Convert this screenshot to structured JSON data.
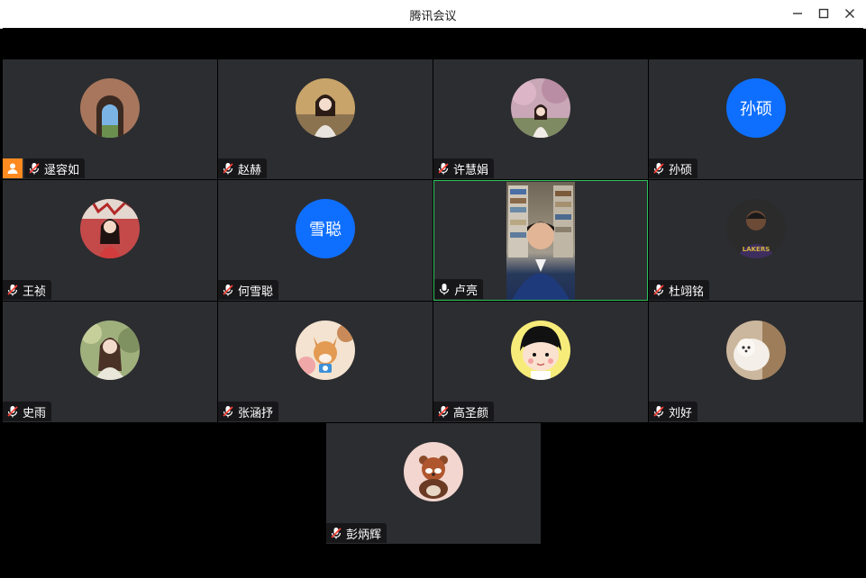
{
  "window": {
    "title": "腾讯会议"
  },
  "participants": [
    {
      "name": "逯容如",
      "avatar": "photo-tunnel",
      "host": true,
      "muted": true
    },
    {
      "name": "赵赫",
      "avatar": "photo-girl-autumn",
      "host": false,
      "muted": true
    },
    {
      "name": "许慧娟",
      "avatar": "photo-girl-blossom",
      "host": false,
      "muted": true
    },
    {
      "name": "孙硕",
      "avatar_text": "孙硕",
      "host": false,
      "muted": true
    },
    {
      "name": "王祯",
      "avatar": "photo-girl-red",
      "host": false,
      "muted": true
    },
    {
      "name": "何雪聪",
      "avatar_text": "雪聪",
      "host": false,
      "muted": true
    },
    {
      "name": "卢亮",
      "avatar": "video-feed",
      "host": false,
      "muted": false,
      "active": true
    },
    {
      "name": "杜翊铭",
      "avatar": "photo-basketball",
      "host": false,
      "muted": true
    },
    {
      "name": "史雨",
      "avatar": "photo-girl-garden",
      "host": false,
      "muted": true
    },
    {
      "name": "张涵抒",
      "avatar": "photo-corgi",
      "host": false,
      "muted": true
    },
    {
      "name": "高圣颜",
      "avatar": "cartoon-girl",
      "host": false,
      "muted": true
    },
    {
      "name": "刘好",
      "avatar": "photo-white-dog",
      "host": false,
      "muted": true
    },
    {
      "name": "彭炳辉",
      "avatar": "cartoon-red-panda",
      "host": false,
      "muted": true
    }
  ],
  "colors": {
    "tile_bg": "#2c2d30",
    "accent_blue": "#0e6fff",
    "host_orange": "#ff8a1f",
    "speaking_green": "#2fc25b"
  }
}
